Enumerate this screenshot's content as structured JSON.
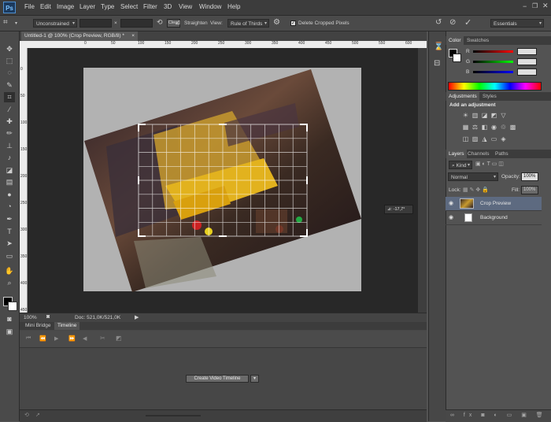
{
  "menubar": {
    "logo": "Ps",
    "items": [
      "File",
      "Edit",
      "Image",
      "Layer",
      "Type",
      "Select",
      "Filter",
      "3D",
      "View",
      "Window",
      "Help"
    ]
  },
  "options": {
    "ratio_value": "Unconstrained",
    "times_sign": "×",
    "clear_label": "Clear",
    "straighten_label": "Straighten",
    "view_label": "View:",
    "view_value": "Rule of Thirds",
    "delete_pixels_label": "Delete Cropped Pixels",
    "delete_pixels_checked": true,
    "workspace_value": "Essentials"
  },
  "document": {
    "tab_title": "Untitled-1 @ 100% (Crop Preview, RGB/8) *",
    "ruler_top_ticks": [
      "0",
      "50",
      "100",
      "150",
      "200",
      "250",
      "300",
      "350",
      "400",
      "450",
      "500",
      "550",
      "600",
      "650",
      "700"
    ],
    "ruler_left_ticks": [
      "0",
      "50",
      "100",
      "150",
      "200",
      "250",
      "300",
      "350",
      "400",
      "450"
    ],
    "angle_readout": "⊿: -17,7°",
    "zoom": "100%",
    "doc_info": "Doc: 521,0K/521,0K"
  },
  "timeline": {
    "tab_minibridge": "Mini Bridge",
    "tab_timeline": "Timeline",
    "create_button": "Create Video Timeline"
  },
  "panels": {
    "color_tab": "Color",
    "swatches_tab": "Swatches",
    "channel_r": "R",
    "channel_g": "G",
    "channel_b": "B",
    "adjustments_tab": "Adjustments",
    "styles_tab": "Styles",
    "add_adjustment": "Add an adjustment",
    "layers_tab": "Layers",
    "channels_tab": "Channels",
    "paths_tab": "Paths",
    "filter_kind": "Kind",
    "blend_mode": "Normal",
    "opacity_label": "Opacity:",
    "opacity_value": "100%",
    "lock_label": "Lock:",
    "fill_label": "Fill:",
    "fill_value": "100%",
    "layers": [
      {
        "name": "Crop Preview",
        "selected": true
      },
      {
        "name": "Background",
        "selected": false
      }
    ]
  },
  "colors": {
    "accent": "#4e8fd0",
    "canvas_bg": "#282828",
    "doc_fill": "#b2b2b2",
    "selected_layer": "#5d6a80"
  }
}
